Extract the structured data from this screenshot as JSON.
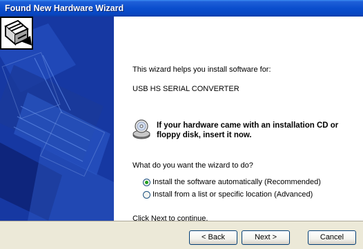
{
  "window": {
    "title": "Found New Hardware Wizard"
  },
  "content": {
    "intro_text": "This wizard helps you install software for:",
    "device_name": "USB HS SERIAL CONVERTER",
    "cd_prompt_line1": "If your hardware came with an installation CD or",
    "cd_prompt_line2": "floppy disk, insert it now.",
    "question": "What do you want the wizard to do?",
    "options": [
      {
        "label": "Install the software automatically (Recommended)",
        "selected": true
      },
      {
        "label": "Install from a list or specific location (Advanced)",
        "selected": false
      }
    ],
    "footer_hint": "Click Next to continue."
  },
  "buttons": {
    "back": "< Back",
    "next": "Next >",
    "cancel": "Cancel"
  },
  "colors": {
    "title_bar": "#0a4ecd",
    "side_panel": "#1b3fb0",
    "radio_selected": "#21a121",
    "dialog_bg": "#ece9d8"
  },
  "icons": {
    "wizard": "hardware-wizard-icon",
    "cd": "cd-icon"
  }
}
